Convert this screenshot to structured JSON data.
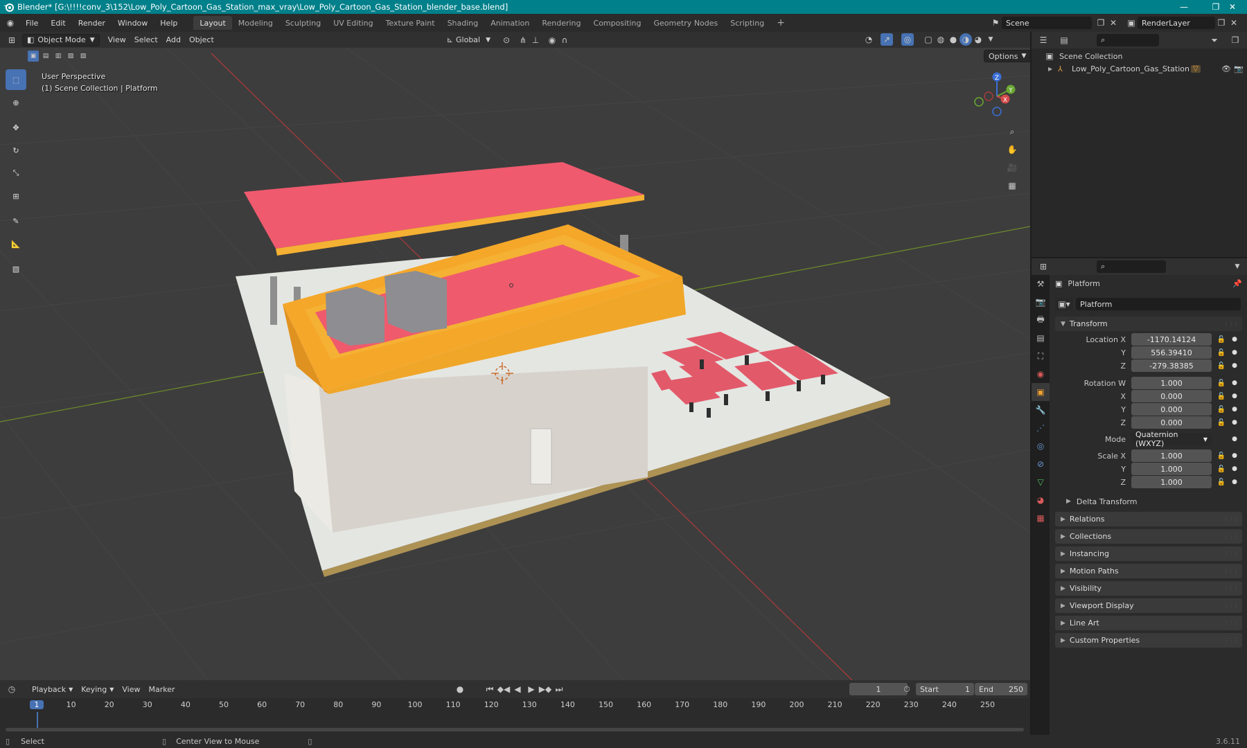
{
  "window": {
    "title": "Blender* [G:\\!!!!conv_3\\152\\Low_Poly_Cartoon_Gas_Station_max_vray\\Low_Poly_Cartoon_Gas_Station_blender_base.blend]",
    "controls": [
      "—",
      "❐",
      "✕"
    ]
  },
  "menu": {
    "items": [
      "File",
      "Edit",
      "Render",
      "Window",
      "Help"
    ],
    "workspaces": [
      "Layout",
      "Modeling",
      "Sculpting",
      "UV Editing",
      "Texture Paint",
      "Shading",
      "Animation",
      "Rendering",
      "Compositing",
      "Geometry Nodes",
      "Scripting"
    ],
    "active_workspace": "Layout",
    "add_tab": "+",
    "scene": "Scene",
    "view_layer": "RenderLayer"
  },
  "viewport": {
    "mode": "Object Mode",
    "menus": [
      "View",
      "Select",
      "Add",
      "Object"
    ],
    "transform_orientation": "Global",
    "options_label": "Options",
    "overlay_line1": "User Perspective",
    "overlay_line2": "(1) Scene Collection | Platform",
    "gizmo_axes": [
      "X",
      "Y",
      "Z"
    ],
    "colors": {
      "canopy": "#f05a6e",
      "trim": "#f5b133",
      "ground": "#e4e6e2",
      "walls": "#d8d2cc",
      "x_axis": "#a83a3a",
      "y_axis": "#6a8a2a"
    }
  },
  "tools": [
    "select-box-icon",
    "cursor-icon",
    "move-icon",
    "rotate-icon",
    "scale-icon",
    "transform-icon",
    "annotate-icon",
    "measure-icon",
    "add-cube-icon"
  ],
  "outliner": {
    "root": "Scene Collection",
    "items": [
      {
        "name": "Low_Poly_Cartoon_Gas_Station"
      }
    ]
  },
  "properties": {
    "object_name": "Platform",
    "data_name": "Platform",
    "transform_title": "Transform",
    "location": {
      "label_x": "Location X",
      "label_y": "Y",
      "label_z": "Z",
      "x": "-1170.14124",
      "y": "556.39410",
      "z": "-279.38385"
    },
    "rotation": {
      "label_w": "Rotation W",
      "label_x": "X",
      "label_y": "Y",
      "label_z": "Z",
      "w": "1.000",
      "x": "0.000",
      "y": "0.000",
      "z": "0.000"
    },
    "mode_label": "Mode",
    "mode_value": "Quaternion (WXYZ)",
    "scale": {
      "label_x": "Scale X",
      "label_y": "Y",
      "label_z": "Z",
      "x": "1.000",
      "y": "1.000",
      "z": "1.000"
    },
    "delta_transform": "Delta Transform",
    "panels": [
      "Relations",
      "Collections",
      "Instancing",
      "Motion Paths",
      "Visibility",
      "Viewport Display",
      "Line Art",
      "Custom Properties"
    ]
  },
  "timeline": {
    "menus": [
      "Playback",
      "Keying",
      "View",
      "Marker"
    ],
    "current_frame": "1",
    "start_label": "Start",
    "start": "1",
    "end_label": "End",
    "end": "250",
    "ruler": [
      "1",
      "10",
      "20",
      "30",
      "40",
      "50",
      "60",
      "70",
      "80",
      "90",
      "100",
      "110",
      "120",
      "130",
      "140",
      "150",
      "160",
      "170",
      "180",
      "190",
      "200",
      "210",
      "220",
      "230",
      "240",
      "250"
    ]
  },
  "status": {
    "select": "Select",
    "center_view": "Center View to Mouse",
    "version": "3.6.11"
  }
}
